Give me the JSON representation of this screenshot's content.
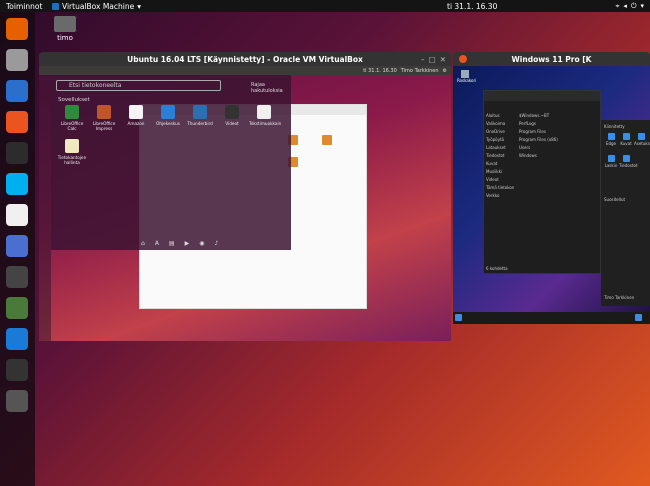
{
  "topbar": {
    "activities": "Toiminnot",
    "app_menu": "VirtualBox Machine",
    "clock": "ti 31.1.  16.30"
  },
  "desktop": {
    "home_label": "timo"
  },
  "dock": {
    "items": [
      {
        "name": "firefox",
        "color": "#e66000"
      },
      {
        "name": "files",
        "color": "#9a9a9a"
      },
      {
        "name": "writer",
        "color": "#2a6fcc"
      },
      {
        "name": "software",
        "color": "#e95420"
      },
      {
        "name": "terminal",
        "color": "#2c2c2c"
      },
      {
        "name": "skype",
        "color": "#00aff0"
      },
      {
        "name": "slack",
        "color": "#f0f0f0"
      },
      {
        "name": "screenshot",
        "color": "#4a6fd0"
      },
      {
        "name": "monitor",
        "color": "#444444"
      },
      {
        "name": "notes",
        "color": "#4a7a3a"
      },
      {
        "name": "virtualbox-display",
        "color": "#1a7ad6"
      },
      {
        "name": "crop",
        "color": "#333333"
      },
      {
        "name": "grid",
        "color": "#555555"
      }
    ]
  },
  "ubuntu_vm": {
    "title": "Ubuntu 16.04 LTS [Käynnistetty] - Oracle VM VirtualBox",
    "search_placeholder": "Etsi tietokoneelta",
    "filter_label": "Rajaa hakutuloksia",
    "section_label": "Sovellukset",
    "apps": [
      {
        "label": "LibreOffice Calc",
        "color": "#2e8b3e"
      },
      {
        "label": "LibreOffice Impress",
        "color": "#c0552a"
      },
      {
        "label": "Amazon",
        "color": "#f5f5f5"
      },
      {
        "label": "Ohjekeskus",
        "color": "#2a7fd6"
      },
      {
        "label": "Thunderbird",
        "color": "#2a6fb0"
      },
      {
        "label": "Videot",
        "color": "#333333"
      },
      {
        "label": "Tekstimuokkain",
        "color": "#f0f0f0"
      },
      {
        "label": "Tietokantojen hallinta",
        "color": "#f0e8c0"
      }
    ],
    "tray": "ti 31.1. 16.30",
    "user": "Timo Tarkkinen"
  },
  "windows_vm": {
    "title": "Windows 11 Pro [K",
    "recycle": "Roskakori",
    "explorer": {
      "nav": [
        "Aloitus",
        "Valikoima",
        "OneDrive",
        "Työpöytä",
        "Lataukset",
        "Tiedostot",
        "Kuvat",
        "Musiikki",
        "Videot",
        "Tämä tietokone",
        "Verkko"
      ],
      "files": [
        "$Windows.~BT",
        "PerfLogs",
        "Program Files",
        "Program Files (x86)",
        "Users",
        "Windows"
      ],
      "status": "6 kohdetta"
    },
    "start": {
      "pinned": "Kiinnitetty",
      "apps": [
        "Edge",
        "Kuvat",
        "Asetukset",
        "Laskin",
        "Tiedostot"
      ],
      "recommended": "Suositellut",
      "user": "Timo Tarkkinen"
    }
  }
}
